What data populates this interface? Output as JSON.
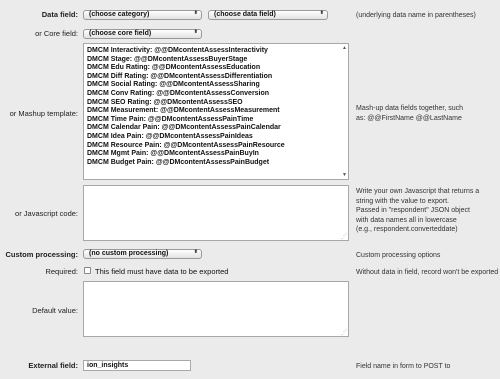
{
  "data_field": {
    "label": "Data field:",
    "category_value": "(choose category)",
    "data_value": "(choose data field)",
    "note": "(underlying data name in parentheses)"
  },
  "core_field": {
    "label": "or Core field:",
    "value": "(choose core field)"
  },
  "mashup": {
    "label": "or Mashup template:",
    "lines": [
      "DMCM Interactivity: @@DMcontentAssessInteractivity",
      "DMCM Stage: @@DMcontentAssessBuyerStage",
      "DMCM Edu Rating: @@DMcontentAssessEducation",
      "DMCM Diff Rating: @@DMcontentAssessDifferentiation",
      "DMCM Social Rating: @@DMcontentAssessSharing",
      "DMCM Conv Rating: @@DMcontentAssessConversion",
      "DMCM SEO Rating: @@DMcontentAssessSEO",
      "DMCM Measurement: @@DMcontentAssessMeasurement",
      "DMCM Time Pain: @@DMcontentAssessPainTime",
      "DMCM Calendar Pain: @@DMcontentAssessPainCalendar",
      "DMCM Idea Pain: @@DMcontentAssessPainIdeas",
      "DMCM Resource Pain: @@DMcontentAssessPainResource",
      "DMCM Mgmt Pain: @@DMcontentAssessPainBuyIn",
      "DMCM Budget Pain: @@DMcontentAssessPainBudget"
    ],
    "note_line1": "Mash-up data fields together, such",
    "note_line2": "as: @@FirstName @@LastName"
  },
  "javascript": {
    "label": "or Javascript code:",
    "value": "",
    "note_lines": [
      "Write your own Javascript that returns a",
      "string with the value to export.",
      "Passed in \"respondent\" JSON object",
      "with data names all in lowercase",
      "(e.g., respondent.converteddate)"
    ]
  },
  "custom_processing": {
    "label": "Custom processing:",
    "value": "(no custom processing)",
    "note": "Custom processing options"
  },
  "required": {
    "label": "Required:",
    "checkbox_label": "This field must have data to be exported",
    "checked": false,
    "note": "Without data in field, record won't be exported"
  },
  "default_value": {
    "label": "Default value:",
    "value": ""
  },
  "external_field": {
    "label": "External field:",
    "value": "ion_insights",
    "note": "Field name in form to POST to"
  },
  "icons": {
    "select_arrow": "⬍",
    "scroll_up": "▲",
    "scroll_down": "▼",
    "resize_grip": "⋰"
  }
}
